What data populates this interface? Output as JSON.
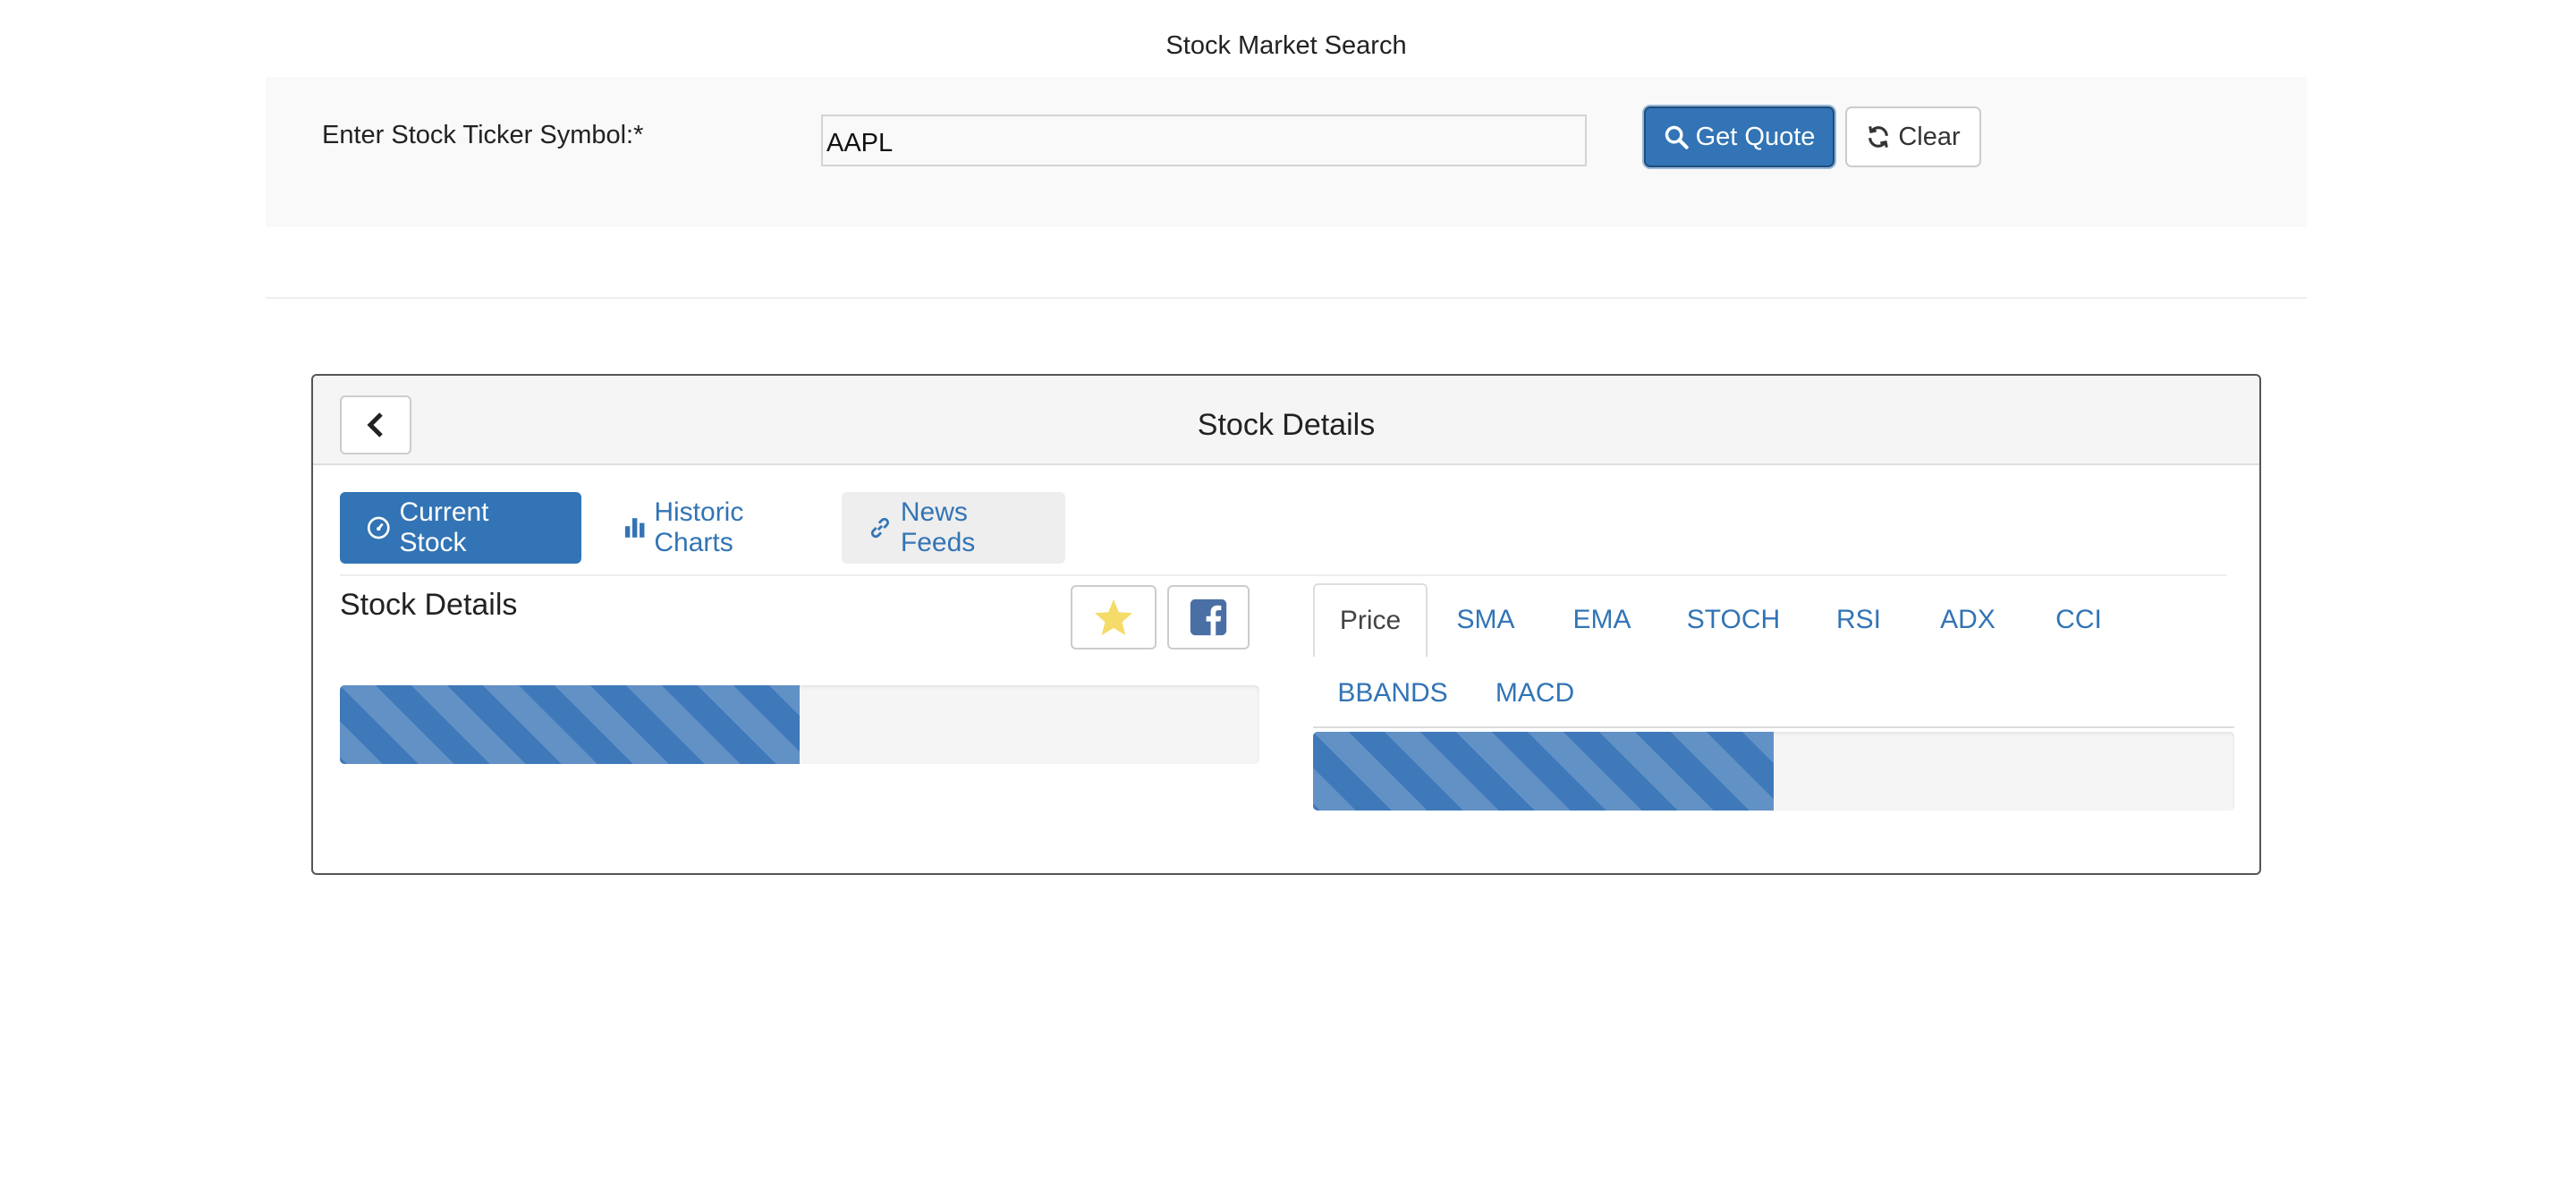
{
  "header": {
    "title": "Stock Market Search"
  },
  "search": {
    "label": "Enter Stock Ticker Symbol:*",
    "input_value": "AAPL",
    "get_quote_label": "Get Quote",
    "clear_label": "Clear"
  },
  "details": {
    "panel_title": "Stock Details",
    "pills": [
      {
        "label": "Current Stock",
        "icon": "gauge-icon",
        "active": true
      },
      {
        "label": "Historic Charts",
        "icon": "bar-chart-icon",
        "active": false
      },
      {
        "label": "News Feeds",
        "icon": "link-icon",
        "active": false
      }
    ],
    "section_heading": "Stock Details",
    "favorite_icon": "star-icon",
    "share_icon": "facebook-icon",
    "left_progress_percent": 50,
    "right_progress_percent": 50,
    "indicator_tabs": [
      "Price",
      "SMA",
      "EMA",
      "STOCH",
      "RSI",
      "ADX",
      "CCI",
      "BBANDS",
      "MACD"
    ],
    "active_indicator": "Price"
  },
  "colors": {
    "primary": "#3274b5",
    "star": "#f5dc6a",
    "facebook": "#4a6fa5"
  }
}
